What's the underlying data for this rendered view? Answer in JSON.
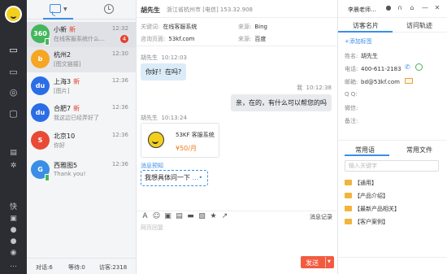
{
  "sidebar": {
    "icons": [
      "chat-icon",
      "monitor-icon",
      "target-icon",
      "crm-icon",
      "settings-icon",
      "fast-icon",
      "group-icon",
      "contacts-icon",
      "user-icon",
      "alert-icon",
      "more-icon"
    ],
    "bottom_labels": [
      "快"
    ]
  },
  "contact_list": {
    "items": [
      {
        "name": "小新",
        "new": "新",
        "time": "12:32",
        "preview": "在线客服系统什么…",
        "badge": "4",
        "avatar_text": "360",
        "avatar_color": "#43b75b"
      },
      {
        "name": "杭州2",
        "new": "",
        "time": "12:30",
        "preview": "[图文链接]",
        "badge": "",
        "avatar_text": "b",
        "avatar_color": "#f5a623"
      },
      {
        "name": "上海3",
        "new": "新",
        "time": "12:36",
        "preview": "[图片]",
        "badge": "",
        "avatar_text": "du",
        "avatar_color": "#2a6de6"
      },
      {
        "name": "合肥7",
        "new": "新",
        "time": "12:36",
        "preview": "我这边已经弄好了",
        "badge": "",
        "avatar_text": "du",
        "avatar_color": "#2a6de6"
      },
      {
        "name": "北京10",
        "new": "",
        "time": "12:36",
        "preview": "你好",
        "badge": "",
        "avatar_text": "S",
        "avatar_color": "#e84a35"
      },
      {
        "name": "西雅图5",
        "new": "",
        "time": "12:36",
        "preview": "Thank you!",
        "badge": "",
        "avatar_text": "G",
        "avatar_color": "#3a8ee6"
      }
    ],
    "footer": {
      "dialog": "对话:6",
      "waiting": "等待:0",
      "visitors": "访客:2318"
    }
  },
  "chat": {
    "visitor_name": "胡先生",
    "location": "浙江省杭州市 [电信] 153.32.908",
    "info": [
      {
        "key": "关键词:",
        "value": "在线客服系统"
      },
      {
        "key": "来源:",
        "value": "Bing"
      },
      {
        "key": "咨询页面:",
        "value": "53kf.com"
      },
      {
        "key": "来源:",
        "value": "百度"
      }
    ],
    "messages": [
      {
        "sender": "胡先生",
        "time": "10:12:03",
        "text": "你好！在吗?"
      },
      {
        "sender": "我",
        "time": "10:12:38",
        "text": "亲，在的，有什么可以帮您的吗"
      },
      {
        "sender": "胡先生",
        "time": "10:13:24"
      }
    ],
    "card": {
      "title": "53KF 客服系统",
      "price": "¥50/月"
    },
    "preview_label": "消息预知",
    "preview_text": "我想具体问一下",
    "history_label": "消息记录",
    "input_placeholder": "网页回复",
    "send_label": "发送"
  },
  "right_panel": {
    "agent": "李晨老师…",
    "tabs": [
      "访客名片",
      "访问轨迹"
    ],
    "add_label": "+添加标签",
    "fields": [
      {
        "key": "姓名:",
        "value": "胡先生"
      },
      {
        "key": "电话:",
        "value": "400-611-2183"
      },
      {
        "key": "邮箱:",
        "value": "bd@53kf.com"
      },
      {
        "key": "Q Q:",
        "value": ""
      },
      {
        "key": "微信:",
        "value": ""
      },
      {
        "key": "备注:",
        "value": ""
      }
    ],
    "tabs2": [
      "常用语",
      "常用文件"
    ],
    "search_placeholder": "输入关键字",
    "folders": [
      "【通用】",
      "【产品介绍】",
      "【最新产品相关】",
      "【客户案例】"
    ]
  }
}
